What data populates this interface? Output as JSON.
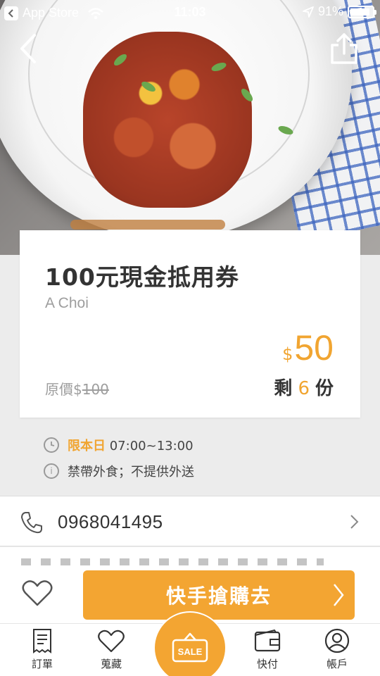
{
  "status_bar": {
    "back_app": "App Store",
    "time": "11:03",
    "battery": "91%",
    "battery_level": 0.91
  },
  "deal": {
    "title": "100元現金抵用券",
    "merchant": "A Choi",
    "price_currency": "$",
    "price": "50",
    "original_label": "原價$",
    "original_price": "100",
    "remain_prefix": "剩",
    "remain_count": "6",
    "remain_suffix": "份"
  },
  "info": {
    "time_label": "限本日",
    "time_range": "07:00~13:00",
    "note": "禁帶外食；不提供外送"
  },
  "contact": {
    "phone": "0968041495"
  },
  "action": {
    "buy_label": "快手搶購去"
  },
  "tabs": [
    {
      "label": "訂單",
      "icon": "receipt-icon"
    },
    {
      "label": "蒐藏",
      "icon": "heart-icon"
    },
    {
      "label": "SALE",
      "icon": "sale-tag-icon"
    },
    {
      "label": "快付",
      "icon": "wallet-icon"
    },
    {
      "label": "帳戶",
      "icon": "user-icon"
    }
  ],
  "colors": {
    "accent": "#f3a532",
    "price": "#f1a531",
    "text": "#333333",
    "muted": "#9e9e9e"
  }
}
